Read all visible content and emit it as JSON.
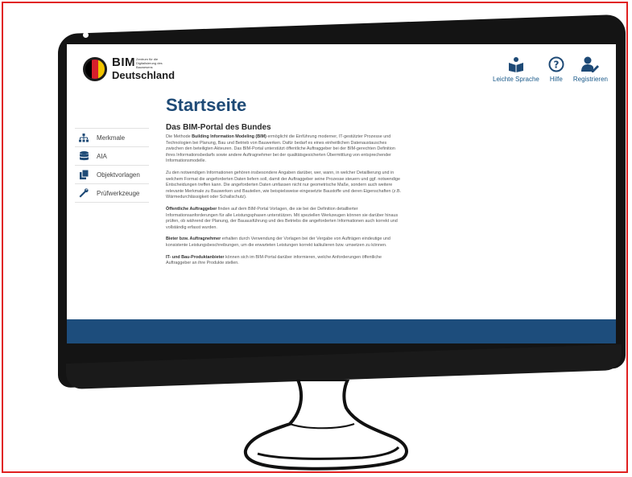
{
  "logo": {
    "bim": "BIM",
    "subtitle": "Zentrum für die Digitalisierung des Bauwesens",
    "deutschland": "Deutschland"
  },
  "header_nav": [
    {
      "label": "Leichte Sprache",
      "icon": "reader-icon"
    },
    {
      "label": "Hilfe",
      "icon": "question-circle-icon"
    },
    {
      "label": "Registrieren",
      "icon": "user-edit-icon"
    }
  ],
  "sidebar": {
    "items": [
      {
        "label": "Merkmale",
        "icon": "sitemap-icon"
      },
      {
        "label": "AIA",
        "icon": "database-icon"
      },
      {
        "label": "Objektvorlagen",
        "icon": "copy-icon"
      },
      {
        "label": "Prüfwerkzeuge",
        "icon": "wrench-icon"
      }
    ]
  },
  "main": {
    "page_title": "Startseite",
    "section_title": "Das BIM-Portal des Bundes",
    "paragraphs": [
      {
        "pre": "Die Methode ",
        "bold": "Building Information Modeling (BIM)",
        "post": " ermöglicht die Einführung moderner, IT-gestützter Prozesse und Technologien bei Planung, Bau und Betrieb von Bauwerken. Dafür bedarf es eines einheitlichen Datenaustausches zwischen den beteiligten Akteuren. Das BIM-Portal unterstützt öffentliche Auftraggeber bei der BIM-gerechten Definition ihres Informationsbedarfs sowie andere Auftragnehmer bei der qualitätsgesicherten Übermittlung von entsprechender Informationsmodelle."
      },
      {
        "pre": "Zu den notwendigen Informationen gehören insbesondere Angaben darüber, wer, wann, in welcher Detaillierung und in welchem Format die angeforderten Daten liefern soll, damit der Auftraggeber seine Prozesse steuern und ggf. notwendige Entscheidungen treffen kann. Die angeforderten Daten umfassen nicht nur geometrische Maße, sondern auch weitere relevante Merkmale zu Bauwerken und Bauteilen, wie beispielsweise eingesetzte Baustoffe und deren Eigenschaften (z.B. Wärmedurchlässigkeit oder Schallschutz).",
        "bold": "",
        "post": ""
      },
      {
        "pre": "",
        "bold": "Öffentliche Auftraggeber",
        "post": " finden auf dem BIM-Portal Vorlagen, die sie bei der Definition detaillierter Informationsanforderungen für alle Leistungsphasen unterstützen. Mit speziellen Werkzeugen können sie darüber hinaus prüfen, ob während der Planung, der Bauausführung und des Betriebs die angeforderten Informationen auch korrekt und vollständig erfasst wurden."
      },
      {
        "pre": "",
        "bold": "Bieter bzw. Auftragnehmer",
        "post": " erhalten durch Verwendung der Vorlagen bei der Vergabe von Aufträgen eindeutige und konsistente Leistungsbeschreibungen, um die erwarteten Leistungen korrekt kalkulieren bzw. umsetzen zu können."
      },
      {
        "pre": "",
        "bold": "IT- und Bau-Produktanbieter",
        "post": " können sich im BIM-Portal darüber informieren, welche Anforderungen öffentliche Auftraggeber an ihre Produkte stellen."
      }
    ]
  },
  "colors": {
    "title": "#1e4a76",
    "accent_nav": "#1a5a8a",
    "footer_band": "#1d4d7c",
    "frame": "#e02020"
  }
}
